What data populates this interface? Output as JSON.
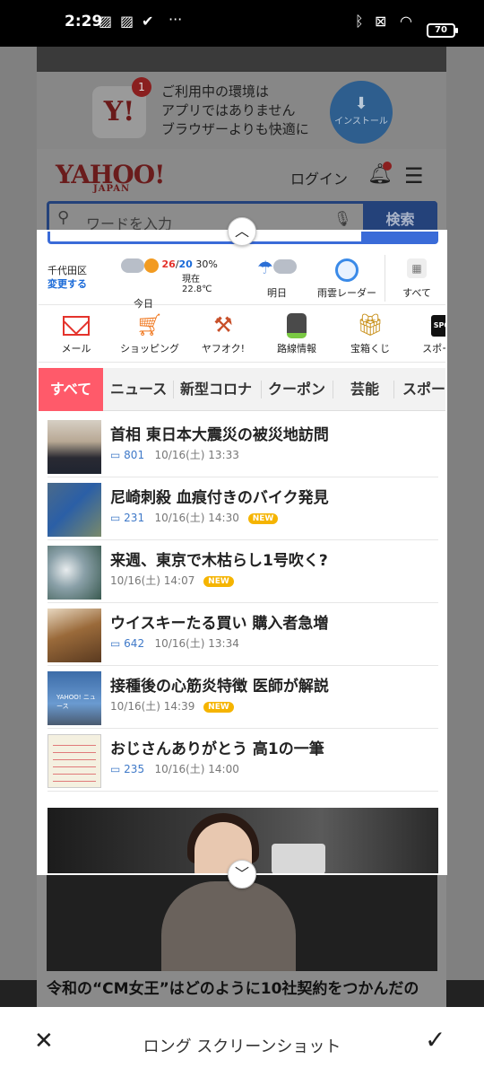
{
  "status_bar": {
    "time": "2:29",
    "battery": "70",
    "more": "···"
  },
  "background_page": {
    "promo_badge": "1",
    "promo_text": [
      "ご利用中の環境は",
      "アプリではありません",
      "ブラウザーよりも快適に"
    ],
    "install_label": "インストール",
    "logo": "YAHOO!",
    "logo_sub": "JAPAN",
    "login_label": "ログイン",
    "search_placeholder": "ワードを入力",
    "search_button": "検索",
    "article_caption": "令和の“CM女王”はどのように10社契約をつかんだの"
  },
  "weather": {
    "location": "千代田区",
    "change_label": "変更する",
    "today_label": "今日",
    "today_high": "26",
    "today_sep": "/",
    "today_low": "20",
    "today_rain": "30%",
    "current_temp": "現在22.8℃",
    "tomorrow_label": "明日",
    "radar_label": "雨雲レーダー",
    "all_label": "すべて"
  },
  "services": [
    {
      "label": "メール",
      "icon": "mail-icon"
    },
    {
      "label": "ショッピング",
      "icon": "cart-icon"
    },
    {
      "label": "ヤフオク!",
      "icon": "auction-hammer-icon"
    },
    {
      "label": "路線情報",
      "icon": "train-icon"
    },
    {
      "label": "宝箱くじ",
      "icon": "treasure-box-icon"
    },
    {
      "label": "スポーツ",
      "icon": "sports-icon",
      "icon_text": "SPO"
    }
  ],
  "tabs": [
    "すべて",
    "ニュース",
    "新型コロナ",
    "クーポン",
    "芸能",
    "スポー"
  ],
  "news": [
    {
      "title": "首相 東日本大震災の被災地訪問",
      "comments": "801",
      "date": "10/16(土) 13:33",
      "is_new": false
    },
    {
      "title": "尼崎刺殺 血痕付きのバイク発見",
      "comments": "231",
      "date": "10/16(土) 14:30",
      "is_new": true
    },
    {
      "title": "来週、東京で木枯らし1号吹く?",
      "comments": "",
      "date": "10/16(土) 14:07",
      "is_new": true
    },
    {
      "title": "ウイスキーたる買い 購入者急増",
      "comments": "642",
      "date": "10/16(土) 13:34",
      "is_new": false
    },
    {
      "title": "接種後の心筋炎特徴 医師が解説",
      "comments": "",
      "date": "10/16(土) 14:39",
      "is_new": true
    },
    {
      "title": "おじさんありがとう 高1の一筆",
      "comments": "235",
      "date": "10/16(土) 14:00",
      "is_new": false
    }
  ],
  "new_badge": "NEW",
  "thumb5_label": "YAHOO! ニュース",
  "toolbar": {
    "title": "ロング スクリーンショット"
  },
  "colors": {
    "active_tab": "#ff5a6a",
    "new_badge": "#f5b400",
    "comment": "#3f79c8",
    "search_border": "#3a6bd8",
    "temp_high": "#e4332c",
    "temp_low": "#1a6ad8"
  }
}
